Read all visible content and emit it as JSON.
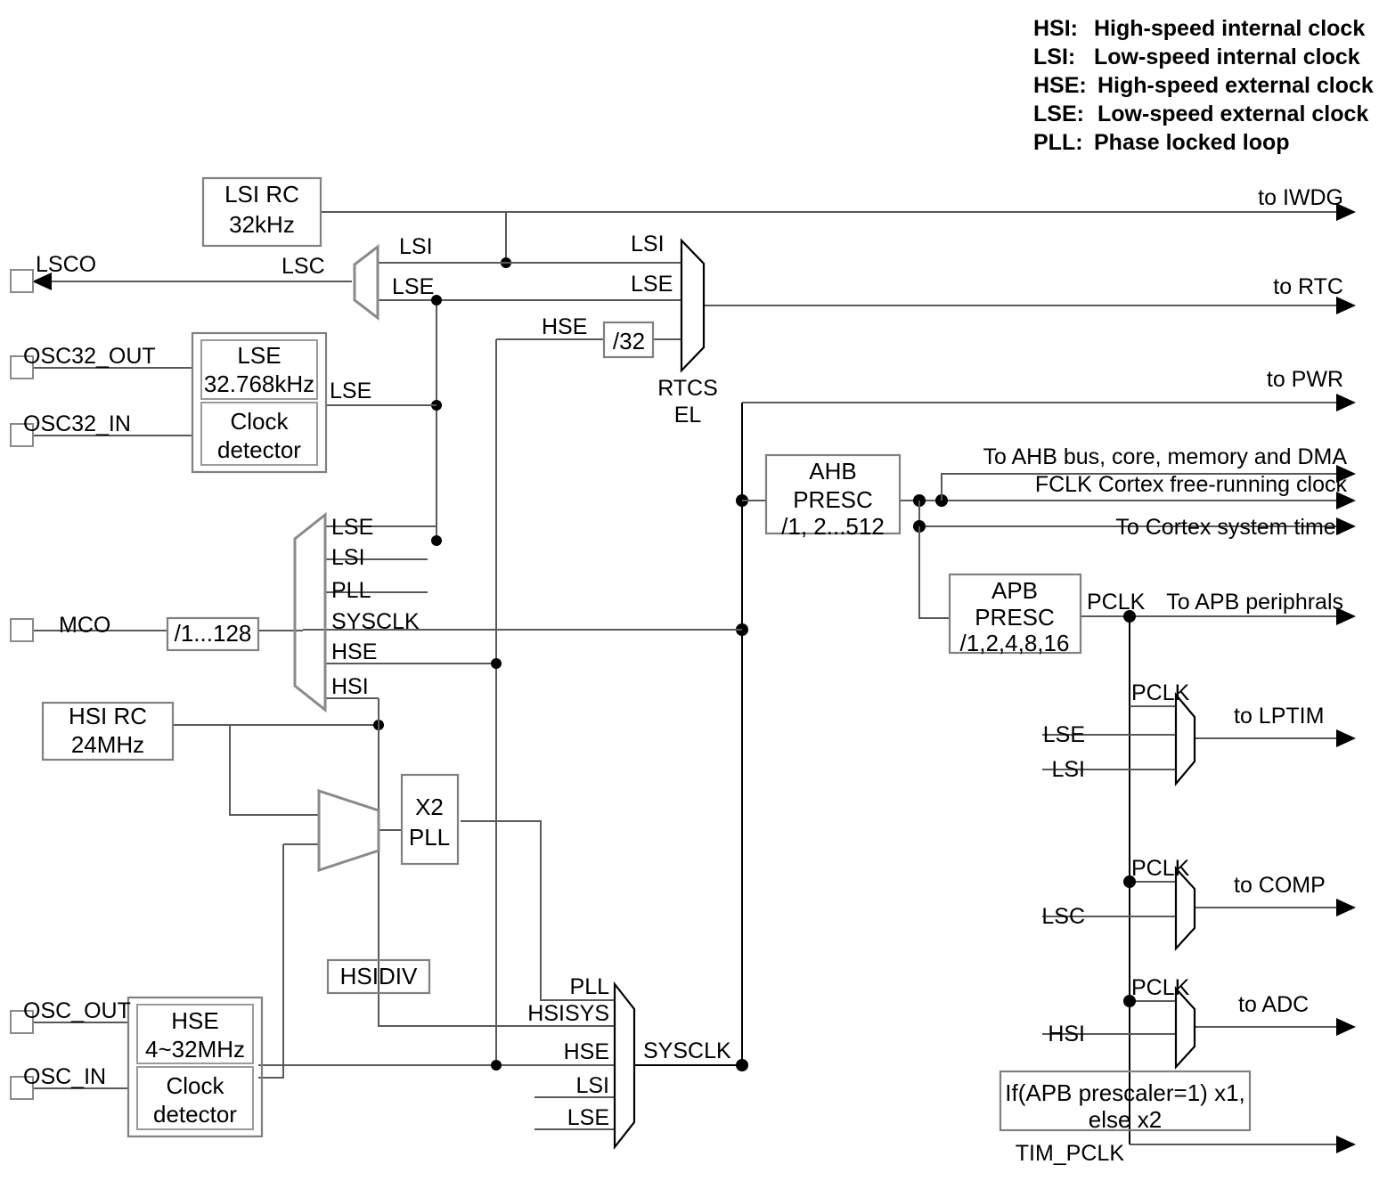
{
  "title": "MCU Clock Tree Diagram",
  "legend": [
    {
      "abbr": "HSI:",
      "desc": "High-speed internal clock"
    },
    {
      "abbr": "LSI:",
      "desc": "Low-speed internal clock"
    },
    {
      "abbr": "HSE:",
      "desc": "High-speed external clock"
    },
    {
      "abbr": "LSE:",
      "desc": "Low-speed external clock"
    },
    {
      "abbr": "PLL:",
      "desc": "Phase locked loop"
    }
  ],
  "blocks": {
    "lsi_rc": {
      "line1": "LSI RC",
      "line2": "32kHz"
    },
    "lse_osc": {
      "line1": "LSE",
      "line2": "32.768kHz"
    },
    "lse_detector": {
      "line1": "Clock",
      "line2": "detector"
    },
    "hsi_rc": {
      "line1": "HSI RC",
      "line2": "24MHz"
    },
    "hse_osc": {
      "line1": "HSE",
      "line2": "4~32MHz"
    },
    "hse_detector": {
      "line1": "Clock",
      "line2": "detector"
    },
    "div32": {
      "label": "/32"
    },
    "mco_div": {
      "label": "/1...128"
    },
    "pll": {
      "line1": "X2",
      "line2": "PLL"
    },
    "hsidiv": {
      "label": "HSIDIV"
    },
    "ahb_presc": {
      "line1": "AHB",
      "line2": "PRESC",
      "line3": "/1, 2...512"
    },
    "apb_presc": {
      "line1": "APB",
      "line2": "PRESC",
      "line3": "/1,2,4,8,16"
    },
    "tim_mult": {
      "line1": "If(APB prescaler=1) x1,",
      "line2": "else x2"
    }
  },
  "pads": {
    "lsco": "LSCO",
    "osc32_out": "OSC32_OUT",
    "osc32_in": "OSC32_IN",
    "mco": "MCO",
    "osc_out": "OSC_OUT",
    "osc_in": "OSC_IN"
  },
  "muxes": {
    "lsc": {
      "name": "LSC",
      "inputs": [
        "LSI",
        "LSE"
      ],
      "output": "LSC"
    },
    "rtcsel": {
      "name_line1": "RTCS",
      "name_line2": "EL",
      "inputs": [
        "LSI",
        "LSE",
        "HSE"
      ],
      "output": ""
    },
    "mco_sel": {
      "inputs": [
        "LSE",
        "LSI",
        "PLL",
        "SYSCLK",
        "HSE",
        "HSI"
      ]
    },
    "pll_src": {
      "inputs": []
    },
    "sysclk_sel": {
      "inputs": [
        "PLL",
        "HSISYS",
        "HSE",
        "LSI",
        "LSE"
      ],
      "output": "SYSCLK"
    },
    "lptim_sel": {
      "inputs": [
        "PCLK",
        "LSE",
        "LSI"
      ],
      "output": "to LPTIM"
    },
    "comp_sel": {
      "inputs": [
        "PCLK",
        "LSC"
      ],
      "output": "to COMP"
    },
    "adc_sel": {
      "inputs": [
        "PCLK",
        "HSI"
      ],
      "output": "to ADC"
    }
  },
  "net_labels": {
    "lse_osc_out": "LSE",
    "hse_to_div32": "HSE",
    "pclk_apb": "PCLK",
    "tim_pclk": "TIM_PCLK"
  },
  "outputs": {
    "iwdg": "to IWDG",
    "rtc": "to RTC",
    "pwr": "to PWR",
    "ahb_bus": "To AHB bus, core, memory and DMA",
    "fclk": "FCLK Cortex free-running clock",
    "systimer": "To Cortex system timer",
    "apb_periph": "To APB periphrals",
    "lptim": "to LPTIM",
    "comp": "to COMP",
    "adc": "to ADC"
  },
  "colors": {
    "wire": "#595959",
    "box_stroke": "#808080",
    "text": "#000000",
    "background": "#ffffff"
  }
}
